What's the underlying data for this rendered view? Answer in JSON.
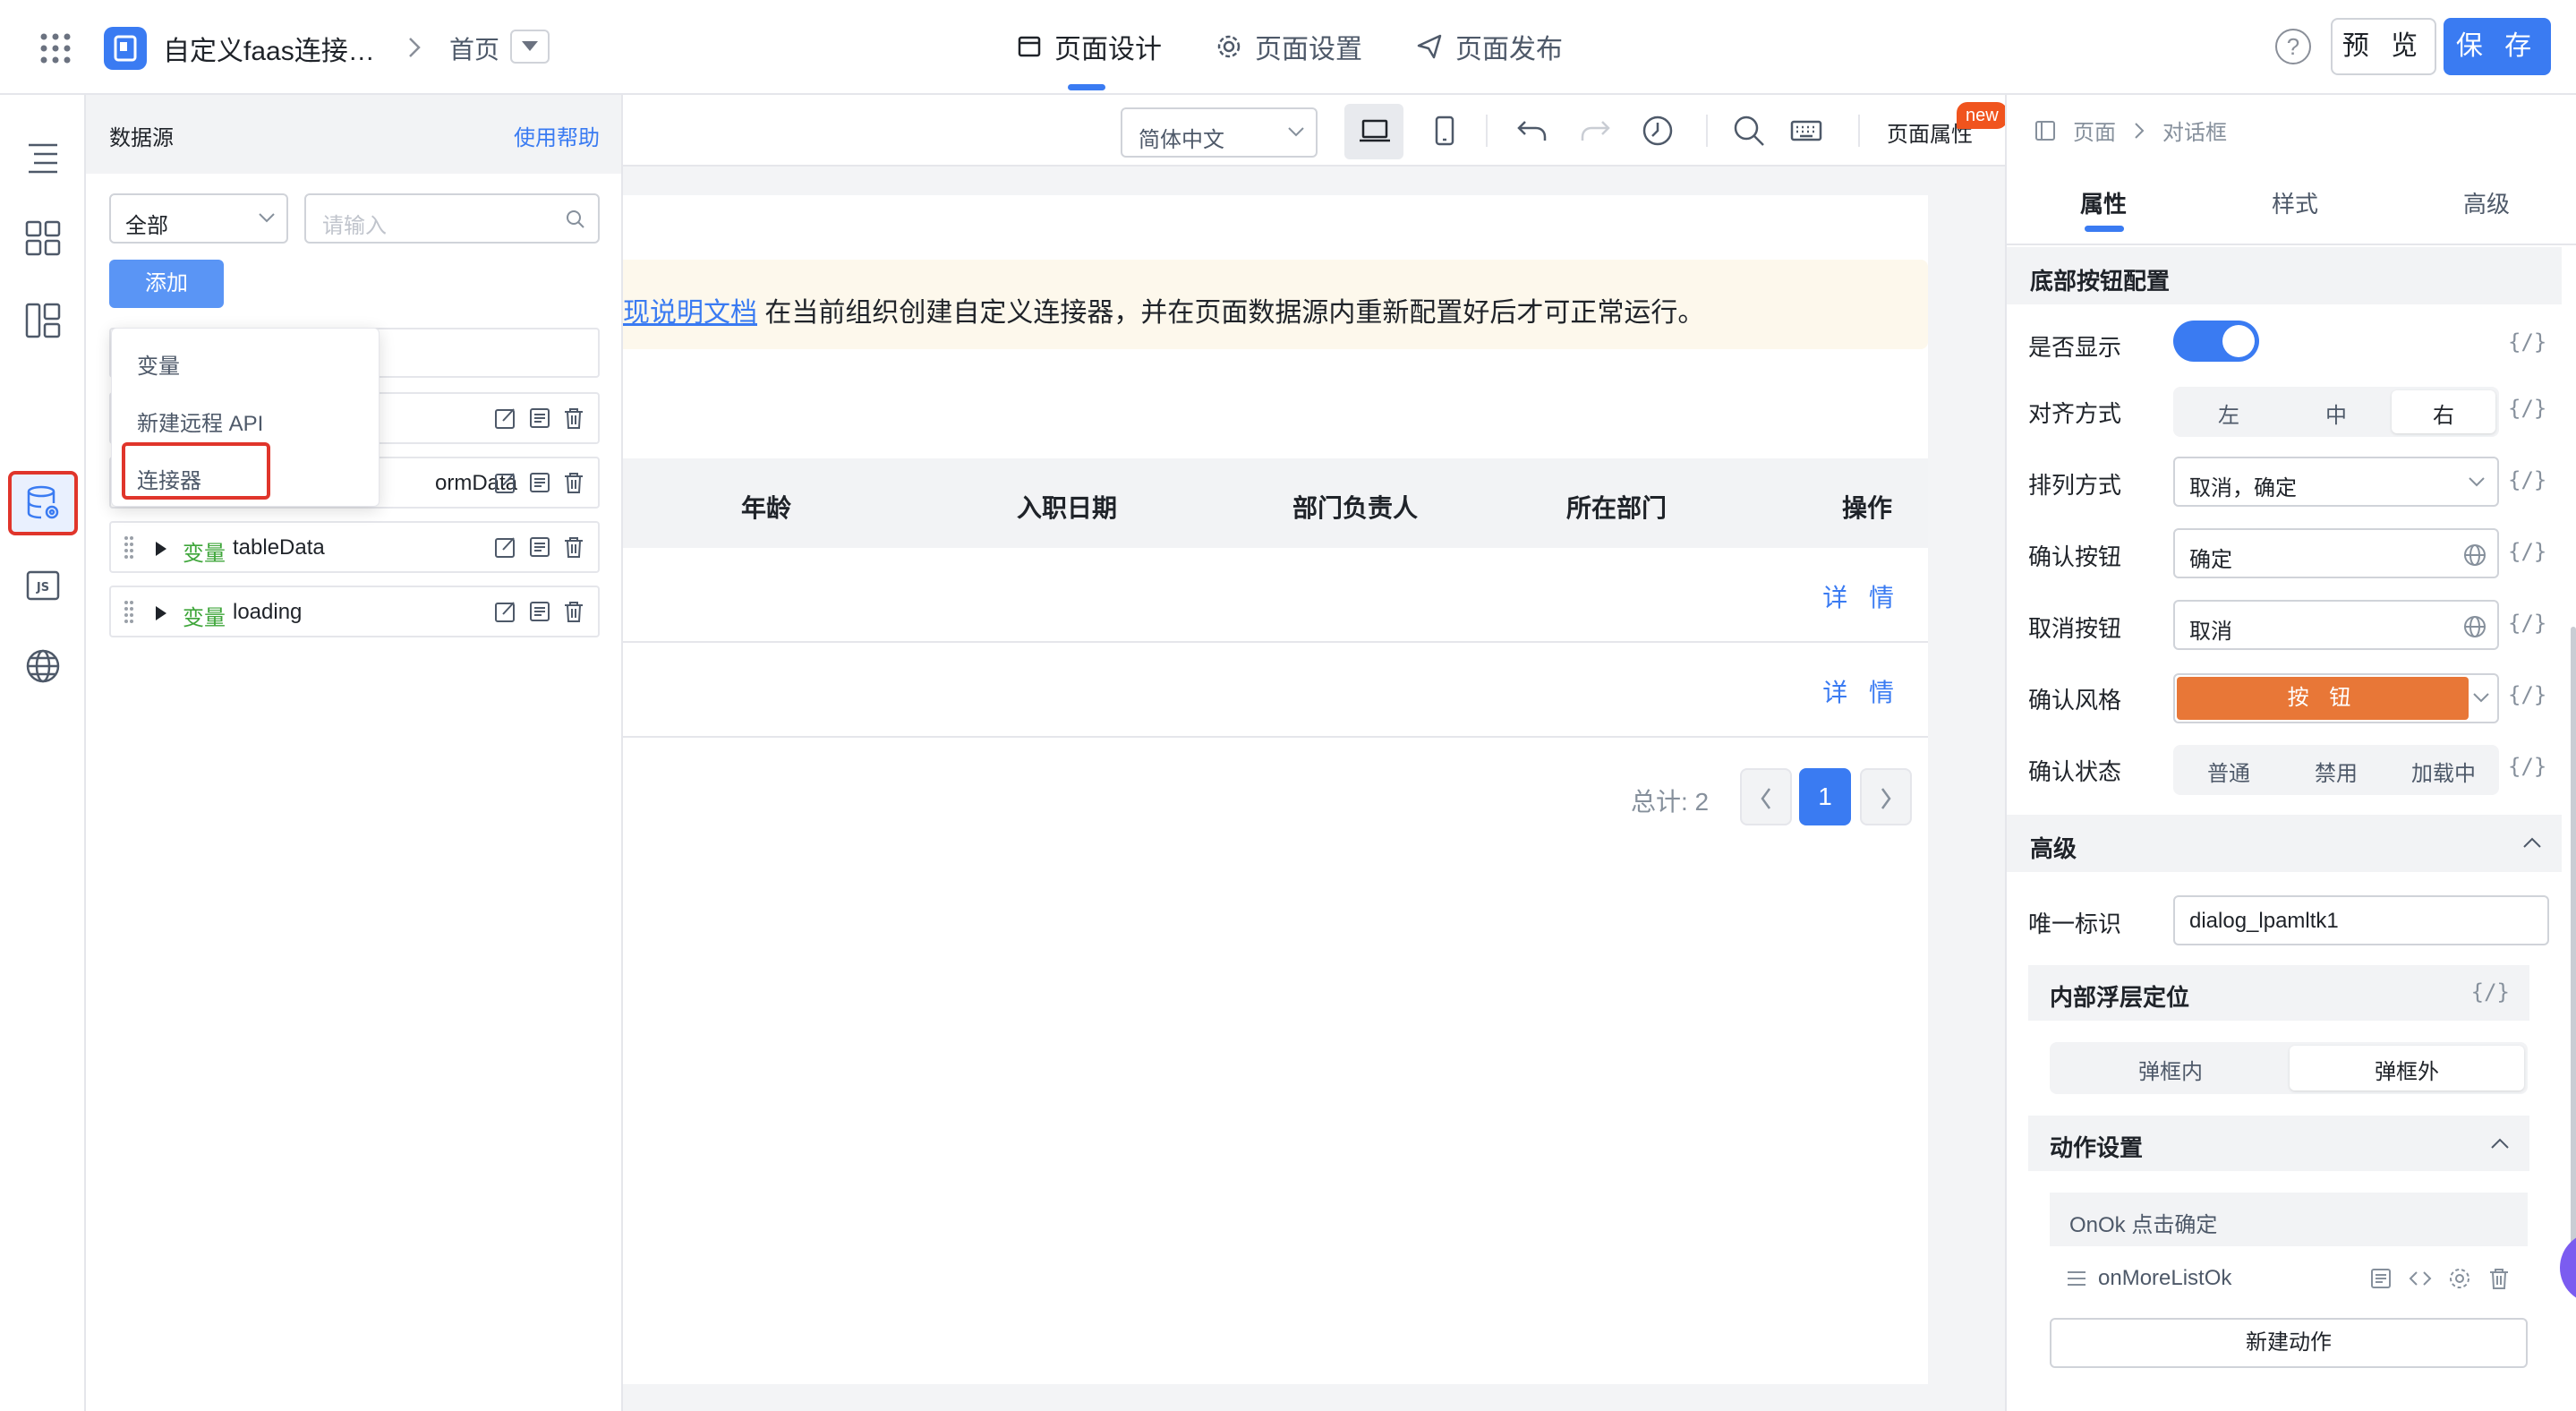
{
  "topbar": {
    "app_title": "自定义faas连接…",
    "breadcrumb_page": "首页",
    "tabs": [
      {
        "label": "页面设计",
        "icon": "layout-icon"
      },
      {
        "label": "页面设置",
        "icon": "gear-icon"
      },
      {
        "label": "页面发布",
        "icon": "send-icon"
      }
    ],
    "help": "?",
    "preview_label": "预 览",
    "save_label": "保 存",
    "accent": "#3a7bf2"
  },
  "rail": {
    "items": [
      "outline-icon",
      "components-icon",
      "templates-icon",
      "datasource-icon",
      "js-icon",
      "globe-icon"
    ],
    "js_label": "JS"
  },
  "datasource": {
    "title": "数据源",
    "help_link": "使用帮助",
    "filter_value": "全部",
    "search_placeholder": "请输入",
    "add_label": "添加",
    "menu": [
      "变量",
      "新建远程 API",
      "连接器"
    ],
    "rows": [
      {
        "kind": "",
        "name": ""
      },
      {
        "kind": "",
        "name": "ormData"
      },
      {
        "kind": "变量",
        "name": "tableData"
      },
      {
        "kind": "变量",
        "name": "loading"
      }
    ]
  },
  "toolbar": {
    "language": "简体中文",
    "page_props": "页面属性",
    "new_badge": "new"
  },
  "canvas": {
    "notice_link": "现说明文档",
    "notice_text": " 在当前组织创建自定义连接器，并在页面数据源内重新配置好后才可正常运行。",
    "columns": [
      "年龄",
      "入职日期",
      "部门负责人",
      "所在部门",
      "操作"
    ],
    "rows": [
      {
        "action": "详 情"
      },
      {
        "action": "详 情"
      }
    ],
    "total": "总计: 2",
    "current_page": "1"
  },
  "props": {
    "breadcrumb": [
      "页面",
      "对话框"
    ],
    "tabs": [
      "属性",
      "样式",
      "高级"
    ],
    "footer_section": "底部按钮配置",
    "show_label": "是否显示",
    "show_on": true,
    "align_label": "对齐方式",
    "align_options": [
      "左",
      "中",
      "右"
    ],
    "order_label": "排列方式",
    "order_value": "取消，确定",
    "confirm_btn_label": "确认按钮",
    "confirm_btn_value": "确定",
    "cancel_btn_label": "取消按钮",
    "cancel_btn_value": "取消",
    "confirm_style_label": "确认风格",
    "confirm_style_value": "按 钮",
    "confirm_style_color": "#e87737",
    "confirm_state_label": "确认状态",
    "confirm_state_options": [
      "普通",
      "禁用",
      "加载中"
    ],
    "expr": "{/}",
    "advanced_section": "高级",
    "uid_label": "唯一标识",
    "uid_value": "dialog_lpamltk1",
    "float_section": "内部浮层定位",
    "float_options": [
      "弹框内",
      "弹框外"
    ],
    "action_section": "动作设置",
    "action_event": "OnOk 点击确定",
    "action_name": "onMoreListOk",
    "new_action": "新建动作"
  }
}
